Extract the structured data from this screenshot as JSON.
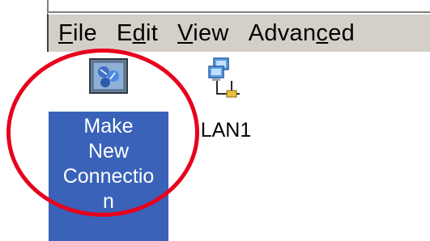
{
  "menubar": {
    "items": [
      {
        "pre": "",
        "mn": "F",
        "post": "ile"
      },
      {
        "pre": "E",
        "mn": "d",
        "post": "it"
      },
      {
        "pre": "",
        "mn": "V",
        "post": "iew"
      },
      {
        "pre": "Advan",
        "mn": "c",
        "post": "ed"
      }
    ]
  },
  "icons": {
    "make_new_connection": {
      "label": "Make\nNew\nConnectio\nn",
      "icon": "make-new-connection-icon"
    },
    "lan1": {
      "label": "LAN1",
      "icon": "network-connection-icon"
    }
  },
  "annotation": {
    "color": "#e8001c",
    "shape": "circle"
  },
  "colors": {
    "selection": "#3a62b8",
    "menubar": "#d4d0c8"
  }
}
